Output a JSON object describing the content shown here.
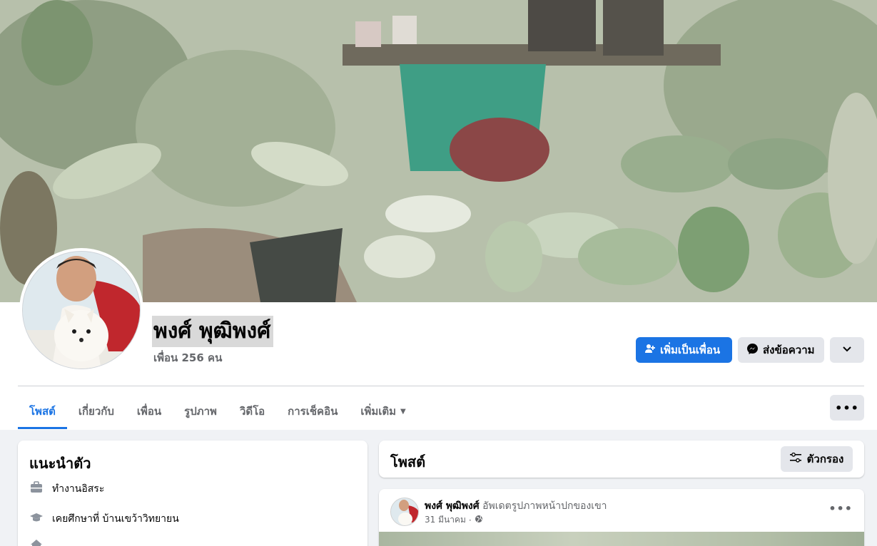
{
  "profile": {
    "name": "พงศ์ พุฒิพงศ์",
    "friends": "เพื่อน 256 คน"
  },
  "actions": {
    "add_friend": "เพิ่มเป็นเพื่อน",
    "message": "ส่งข้อความ"
  },
  "tabs": [
    {
      "label": "โพสต์",
      "active": true
    },
    {
      "label": "เกี่ยวกับ"
    },
    {
      "label": "เพื่อน"
    },
    {
      "label": "รูปภาพ"
    },
    {
      "label": "วิดีโอ"
    },
    {
      "label": "การเช็คอิน"
    },
    {
      "label": "เพิ่มเติม"
    }
  ],
  "intro": {
    "title": "แนะนำตัว",
    "items": [
      {
        "icon": "briefcase-icon",
        "text": "ทำงานอิสระ"
      },
      {
        "icon": "graduation-cap-icon",
        "text": "เคยศึกษาที่ บ้านเขว้าวิทยายน"
      }
    ]
  },
  "posts_section": {
    "title": "โพสต์",
    "filter_label": "ตัวกรอง"
  },
  "post": {
    "author": "พงศ์ พุฒิพงศ์",
    "action": "อัพเดตรูปภาพหน้าปกของเขา",
    "date": "31 มีนาคม",
    "separator": "·"
  },
  "colors": {
    "accent": "#1b74e4",
    "secondary_button": "#e4e6eb",
    "background": "#f0f2f5"
  }
}
